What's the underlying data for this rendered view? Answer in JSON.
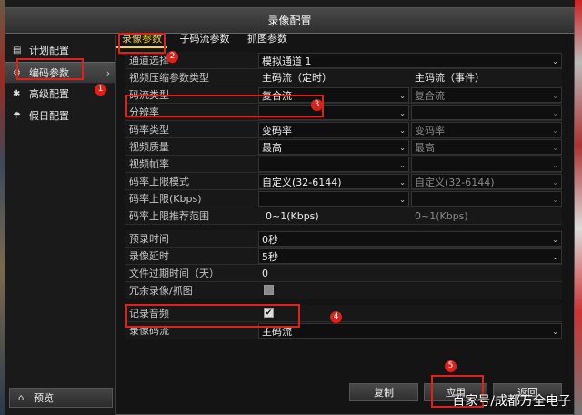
{
  "window": {
    "title": "录像配置"
  },
  "sidebar": {
    "items": [
      {
        "label": "计划配置",
        "icon": "calendar-icon"
      },
      {
        "label": "编码参数",
        "icon": "gear-icon",
        "active": true
      },
      {
        "label": "高级配置",
        "icon": "advanced-icon"
      },
      {
        "label": "假日配置",
        "icon": "holiday-icon"
      }
    ],
    "preview": "预览"
  },
  "tabs": [
    {
      "label": "录像参数",
      "active": true
    },
    {
      "label": "子码流参数"
    },
    {
      "label": "抓图参数"
    }
  ],
  "form": {
    "channel": {
      "label": "通道选择",
      "value": "模拟通道 1"
    },
    "compress_type": {
      "label": "视频压缩参数类型",
      "col1": "主码流（定时）",
      "col2": "主码流（事件）"
    },
    "stream_type": {
      "label": "码流类型",
      "col1": "复合流",
      "col2": "复合流"
    },
    "resolution": {
      "label": "分辨率",
      "col1": "",
      "col2": ""
    },
    "bitrate_type": {
      "label": "码率类型",
      "col1": "变码率",
      "col2": "变码率"
    },
    "video_quality": {
      "label": "视频质量",
      "col1": "最高",
      "col2": "最高"
    },
    "frame_rate": {
      "label": "视频帧率",
      "col1": "",
      "col2": ""
    },
    "bitrate_limit_mode": {
      "label": "码率上限模式",
      "col1": "自定义(32-6144)",
      "col2": "自定义(32-6144)"
    },
    "bitrate_limit": {
      "label": "码率上限(Kbps)",
      "col1": "",
      "col2": ""
    },
    "bitrate_recommend": {
      "label": "码率上限推荐范围",
      "col1": "0~1(Kbps)",
      "col2": "0~1(Kbps)"
    },
    "pre_record": {
      "label": "预录时间",
      "value": "0秒"
    },
    "post_record": {
      "label": "录像延时",
      "value": "5秒"
    },
    "expire": {
      "label": "文件过期时间（天）",
      "value": "0"
    },
    "redundant": {
      "label": "冗余录像/抓图",
      "checked": false
    },
    "record_audio": {
      "label": "记录音频",
      "checked": true
    },
    "record_stream": {
      "label": "录像码流",
      "value": "主码流"
    }
  },
  "buttons": {
    "copy": "复制",
    "apply": "应用",
    "back": "返回"
  },
  "annotations": [
    "1",
    "2",
    "3",
    "4",
    "5"
  ],
  "watermark": "百家号/成都万全电子",
  "colors": {
    "highlight": "#e0201a",
    "active_tab": "#f3d23b"
  }
}
